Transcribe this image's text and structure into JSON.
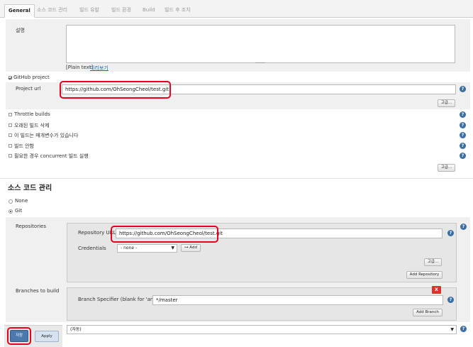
{
  "tabs": [
    "General",
    "소스 코드 관리",
    "빌드 유발",
    "빌드 환경",
    "Build",
    "빌드 후 조치"
  ],
  "general": {
    "description_label": "설명",
    "plain_text": "[Plain text]",
    "preview_link": "미리보기",
    "github_project_label": "GitHub project",
    "project_url_label": "Project url",
    "project_url_value": "https://github.com/OhSeongCheol/test.git",
    "advanced_label": "고급...",
    "options": [
      {
        "label": "Throttle builds",
        "checked": false
      },
      {
        "label": "오래된 빌드 삭제",
        "checked": false
      },
      {
        "label": "이 빌드는 매개변수가 있습니다",
        "checked": false
      },
      {
        "label": "빌드 안함",
        "checked": false
      },
      {
        "label": "필요한 경우 concurrent 빌드 실행",
        "checked": false
      }
    ],
    "advanced_label_2": "고급..."
  },
  "scm": {
    "heading": "소스 코드 관리",
    "none_label": "None",
    "git_label": "Git",
    "repositories_label": "Repositories",
    "repo_url_label": "Repository URL",
    "repo_url_value": "https://github.com/OhSeongCheol/test.git",
    "credentials_label": "Credentials",
    "credentials_value": "- none -",
    "add_label": "Add",
    "advanced_label": "고급...",
    "add_repository_label": "Add Repository",
    "branches_label": "Branches to build",
    "branch_specifier_label": "Branch Specifier (blank for 'any')",
    "branch_specifier_value": "*/master",
    "delete_label": "X",
    "add_branch_label": "Add Branch",
    "repo_browser_value": "(자동)"
  },
  "footer": {
    "save_label": "저장",
    "apply_label": "Apply"
  },
  "colors": {
    "highlight": "#e8001c",
    "help": "#3b6ea5",
    "band": "#f0f0f0"
  }
}
